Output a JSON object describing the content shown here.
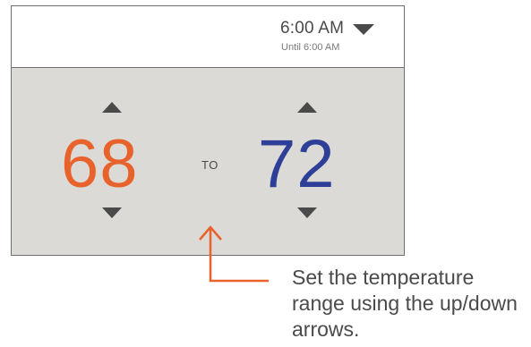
{
  "header": {
    "time": "6:00 AM",
    "until": "Until 6:00 AM"
  },
  "range": {
    "low": "68",
    "separator": "TO",
    "high": "72"
  },
  "callout": {
    "text": "Set the temperature range using the up/down arrows."
  },
  "colors": {
    "low_temp": "#e8622c",
    "high_temp": "#2e3f97",
    "panel_bg": "#dcdad6",
    "callout_line": "#e8622c"
  },
  "icons": {
    "time_dropdown": "caret-down-icon",
    "increase": "triangle-up-icon",
    "decrease": "triangle-down-icon"
  }
}
